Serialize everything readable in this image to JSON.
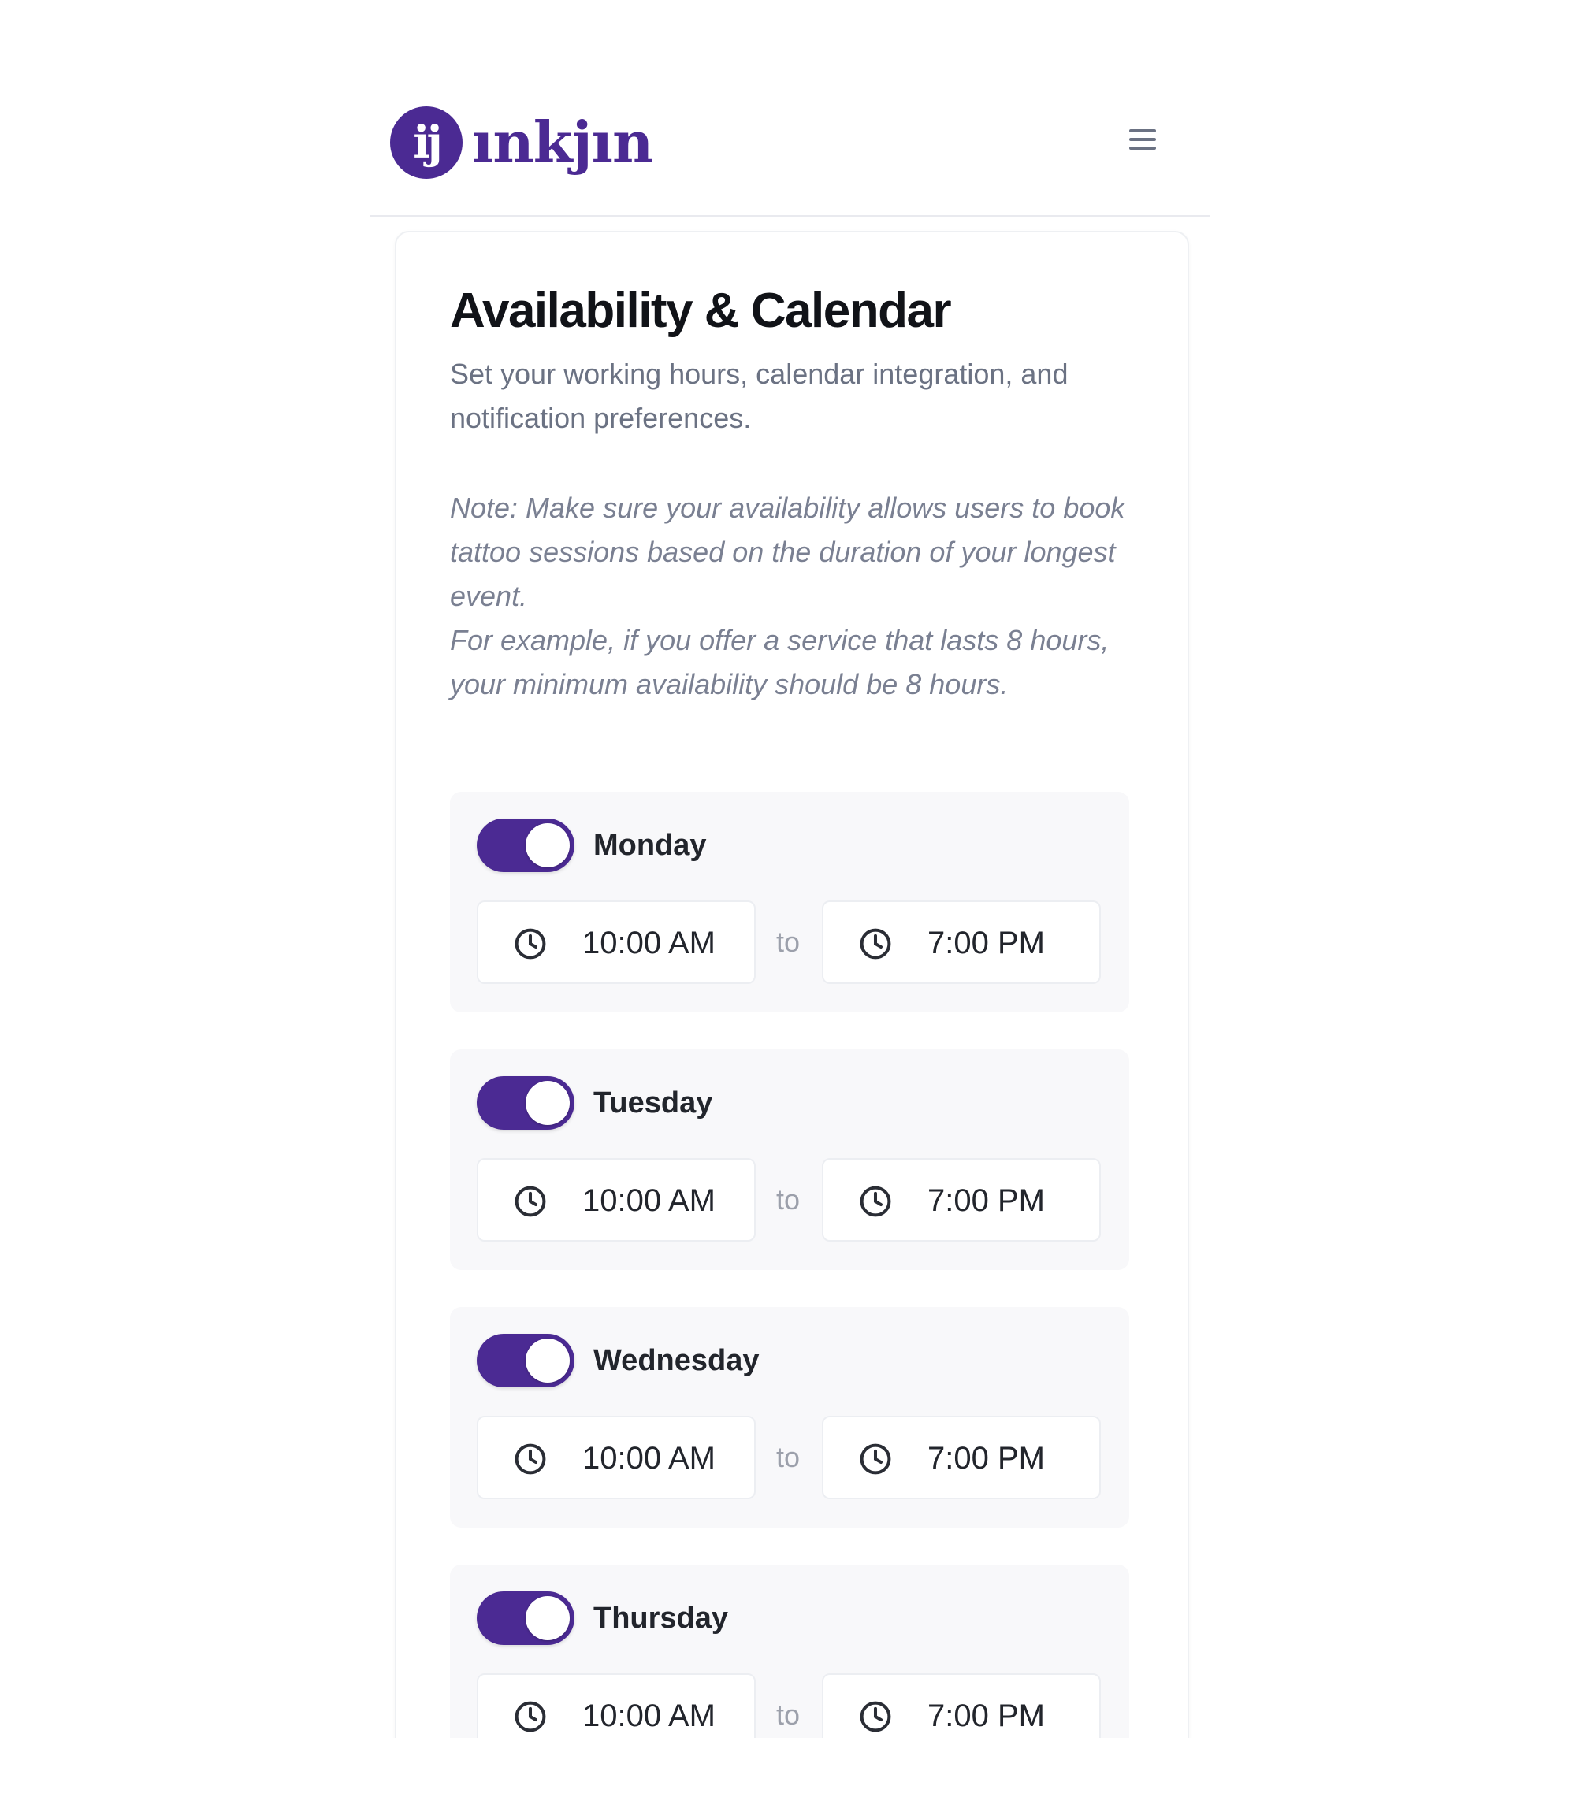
{
  "brand": {
    "logo_mark": "ij",
    "name": "ınkjın",
    "accent_color": "#4b2a93"
  },
  "header": {
    "menu_icon": "hamburger-menu-icon"
  },
  "page": {
    "title": "Availability & Calendar",
    "subtitle": "Set your working hours, calendar integration, and notification preferences.",
    "note": "Note: Make sure your availability allows users to book tattoo sessions based on the duration of your longest event.\nFor example, if you offer a service that lasts 8 hours, your minimum availability should be 8 hours."
  },
  "days": [
    {
      "name": "Monday",
      "enabled": true,
      "start": "10:00 AM",
      "end": "7:00 PM",
      "separator": "to"
    },
    {
      "name": "Tuesday",
      "enabled": true,
      "start": "10:00 AM",
      "end": "7:00 PM",
      "separator": "to"
    },
    {
      "name": "Wednesday",
      "enabled": true,
      "start": "10:00 AM",
      "end": "7:00 PM",
      "separator": "to"
    },
    {
      "name": "Thursday",
      "enabled": true,
      "start": "10:00 AM",
      "end": "7:00 PM",
      "separator": "to"
    }
  ],
  "icons": {
    "time": "clock-icon"
  }
}
